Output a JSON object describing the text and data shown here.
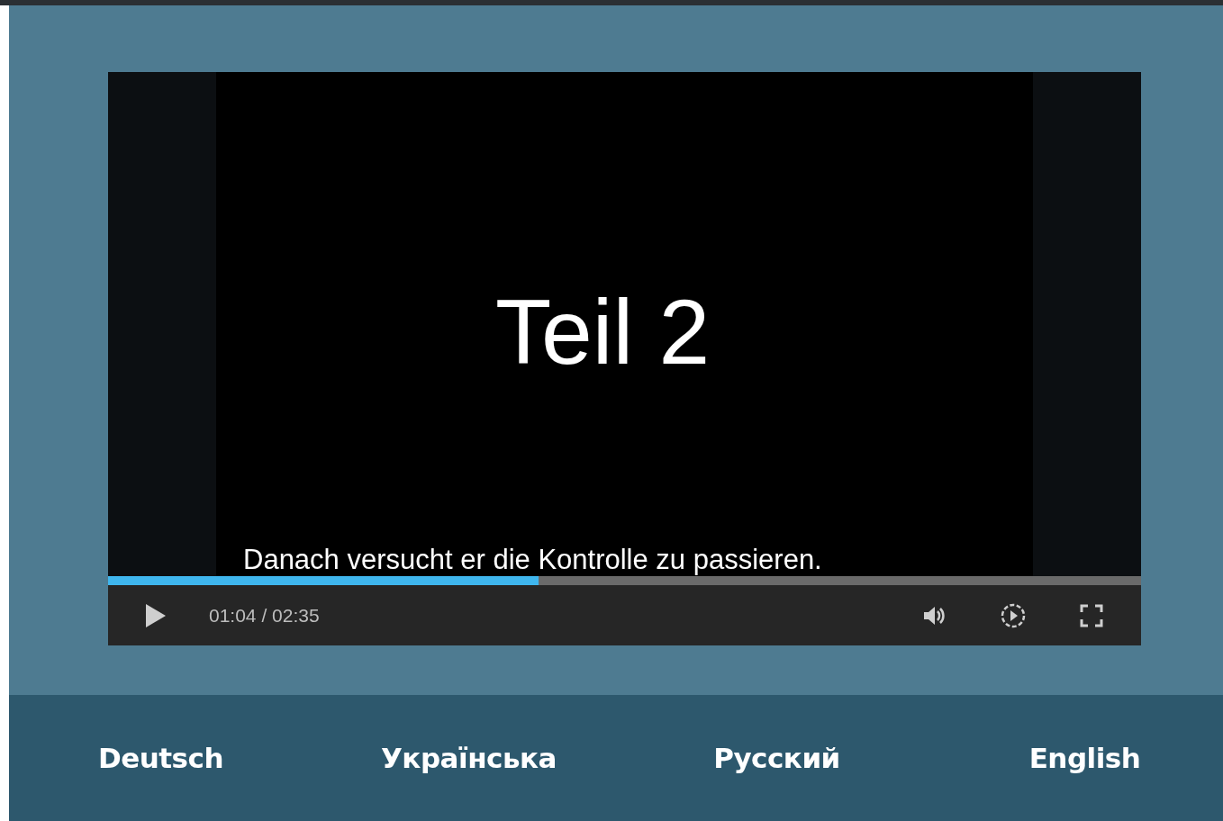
{
  "video": {
    "title_card": "Teil 2",
    "subtitle": "Danach versucht er die Kontrolle zu passieren."
  },
  "player": {
    "playing": false,
    "progress": {
      "level": 0.417
    },
    "time": "01:04 / 02:35"
  },
  "languages": [
    {
      "label": "Deutsch"
    },
    {
      "label": "Українська"
    },
    {
      "label": "Русский"
    },
    {
      "label": "English"
    }
  ]
}
